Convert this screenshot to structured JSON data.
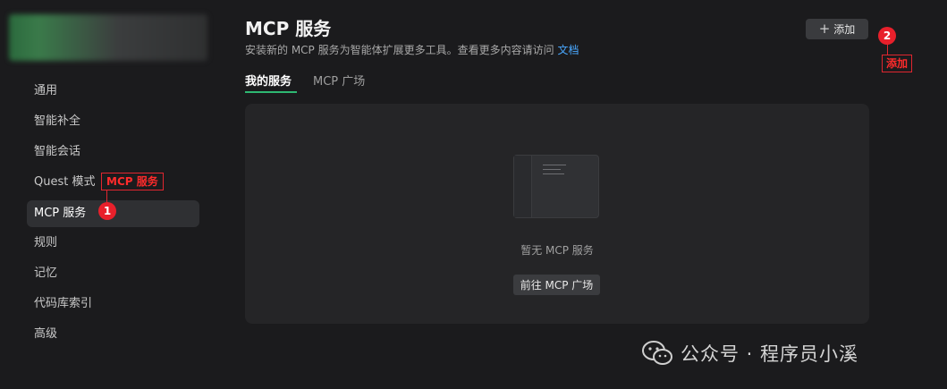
{
  "sidebar": {
    "items": [
      {
        "label": "通用",
        "active": false
      },
      {
        "label": "智能补全",
        "active": false
      },
      {
        "label": "智能会话",
        "active": false
      },
      {
        "label": "Quest 模式",
        "active": false
      },
      {
        "label": "MCP 服务",
        "active": true
      },
      {
        "label": "规则",
        "active": false
      },
      {
        "label": "记忆",
        "active": false
      },
      {
        "label": "代码库索引",
        "active": false
      },
      {
        "label": "高级",
        "active": false
      }
    ]
  },
  "header": {
    "title": "MCP 服务",
    "subtitle": "安装新的 MCP 服务为智能体扩展更多工具。查看更多内容请访问",
    "doc_link": "文档",
    "add_button": "添加",
    "add_icon": "plus-icon"
  },
  "tabs": [
    {
      "label": "我的服务",
      "active": true
    },
    {
      "label": "MCP 广场",
      "active": false
    }
  ],
  "empty_state": {
    "message": "暂无 MCP 服务",
    "action": "前往 MCP 广场"
  },
  "annotations": {
    "label_1": "MCP 服务",
    "badge_1": "1",
    "label_2": "添加",
    "badge_2": "2",
    "color": "#e8202b"
  },
  "watermark": {
    "text": "公众号 · 程序员小溪",
    "icon": "wechat-icon"
  },
  "colors": {
    "accent": "#2eb872",
    "link": "#4aa8ff",
    "background": "#1b1b1d"
  }
}
